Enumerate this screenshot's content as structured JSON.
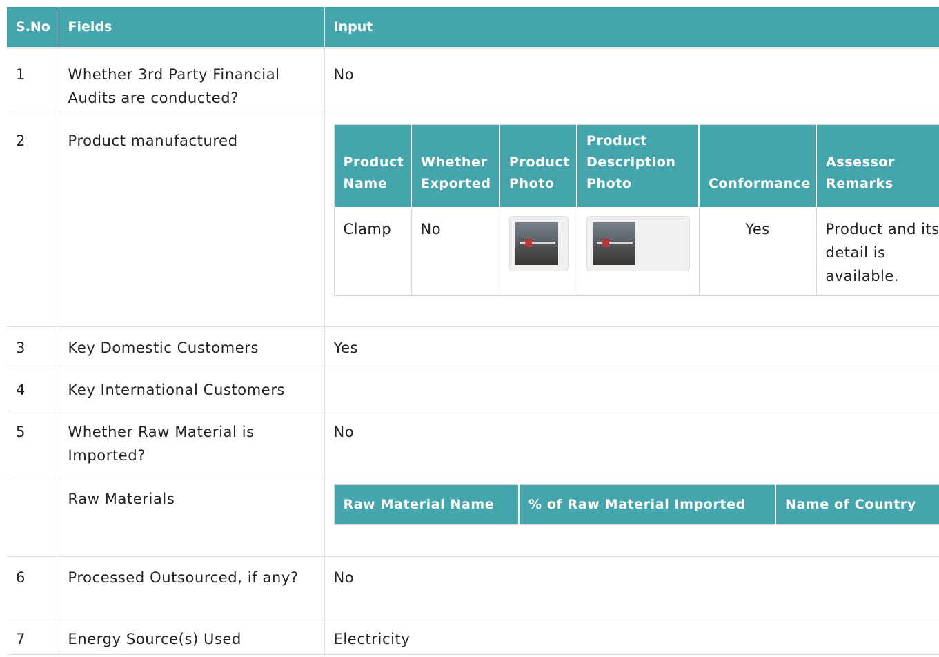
{
  "header": {
    "sno": "S.No",
    "fields": "Fields",
    "input": "Input"
  },
  "rows": [
    {
      "sno": "1",
      "field": "Whether 3rd Party Financial Audits are conducted?",
      "input": "No"
    },
    {
      "sno": "2",
      "field": "Product manufactured"
    },
    {
      "sno": "3",
      "field": "Key Domestic Customers",
      "input": "Yes"
    },
    {
      "sno": "4",
      "field": "Key International Customers",
      "input": ""
    },
    {
      "sno": "5",
      "field": "Whether Raw Material is Imported?",
      "input": "No"
    },
    {
      "sno": "",
      "field": "Raw Materials"
    },
    {
      "sno": "6",
      "field": "Processed Outsourced, if any?",
      "input": "No"
    },
    {
      "sno": "7",
      "field": "Energy Source(s) Used",
      "input": "Electricity"
    }
  ],
  "products_table": {
    "headers": [
      "Product Name",
      "Whether Exported",
      "Product Photo",
      "Product Description Photo",
      "Conformance",
      "Assessor Remarks"
    ],
    "rows": [
      {
        "name": "Clamp",
        "exported": "No",
        "conformance": "Yes",
        "remarks": "Product and its detail is available."
      }
    ]
  },
  "raw_materials_table": {
    "headers": [
      "Raw Material Name",
      "% of Raw Material Imported",
      "Name of Country"
    ]
  }
}
